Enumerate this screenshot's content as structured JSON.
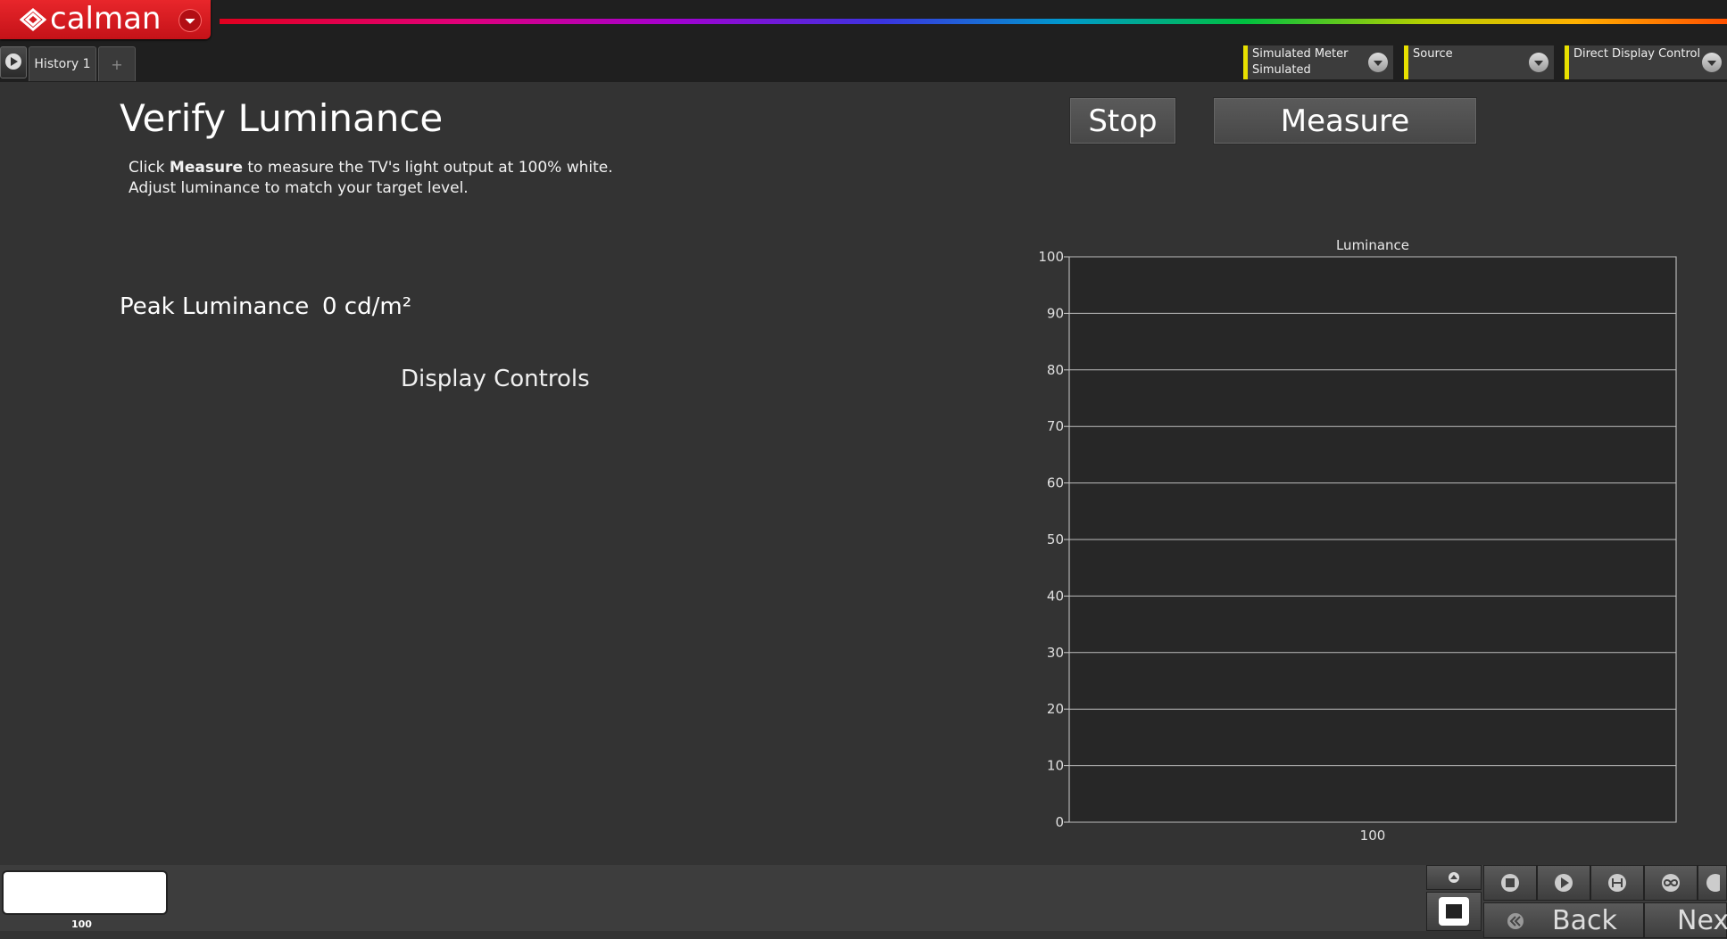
{
  "app": {
    "logo": "calman"
  },
  "tabs": {
    "history_label": "History 1",
    "add_label": "+"
  },
  "devices": [
    {
      "name": "Simulated Meter",
      "value": "Simulated"
    },
    {
      "name": "Source",
      "value": ""
    },
    {
      "name": "Direct Display Control",
      "value": ""
    }
  ],
  "page": {
    "title": "Verify Luminance",
    "desc_prefix": "Click ",
    "desc_bold": "Measure",
    "desc_suffix": " to measure the TV's light output at 100% white.",
    "desc_line2": "Adjust luminance to match your target level."
  },
  "buttons": {
    "stop": "Stop",
    "measure": "Measure"
  },
  "readout": {
    "label": "Peak Luminance",
    "value": "0 cd/m²"
  },
  "display_controls": {
    "heading": "Display Controls"
  },
  "colors": {
    "accent": "#e8262b",
    "device_marker": "#e8e000"
  },
  "chart_data": {
    "type": "bar",
    "title": "Luminance",
    "categories": [
      "100"
    ],
    "values": [
      0
    ],
    "ylim": [
      0,
      100
    ],
    "yticks": [
      0,
      10,
      20,
      30,
      40,
      50,
      60,
      70,
      80,
      90,
      100
    ],
    "grid": true
  },
  "bottom": {
    "swatch_label": "100",
    "back_label": "Back",
    "next_label": "Nex"
  }
}
